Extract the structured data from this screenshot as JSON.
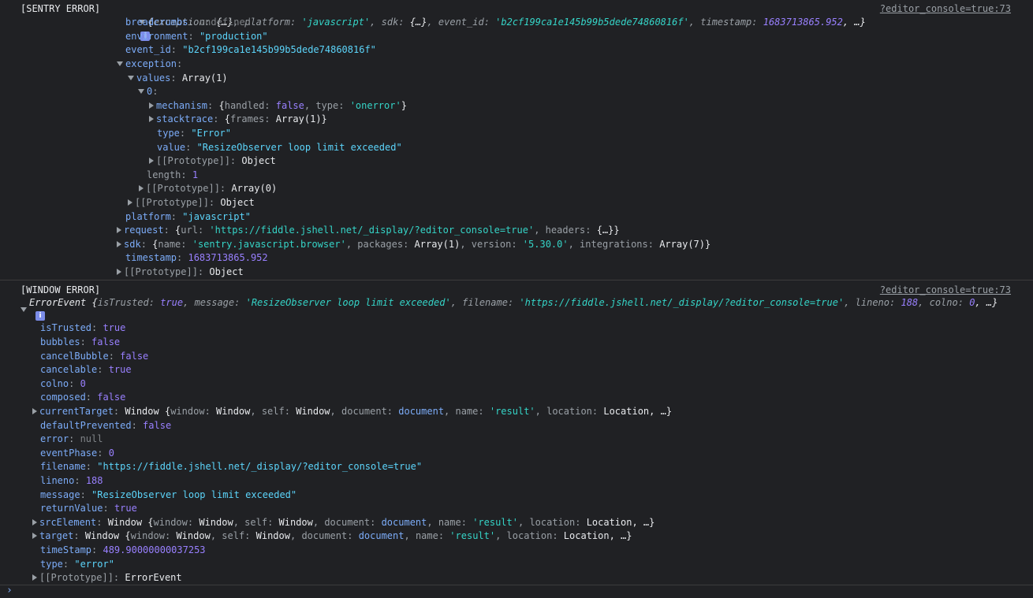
{
  "sentry": {
    "tag": "[SENTRY ERROR]",
    "source": "?editor_console=true:73",
    "summary": {
      "open": "{",
      "k1": "exception",
      "v1": "{…}",
      "k2": "platform",
      "v2": "'javascript'",
      "k3": "sdk",
      "v3": "{…}",
      "k4": "event_id",
      "v4": "'b2cf199ca1e145b99b5dede74860816f'",
      "k5": "timestamp",
      "v5": "1683713865.952",
      "tail": ", …}"
    },
    "breadcrumbs": {
      "key": "breadcrumbs",
      "val": "undefined"
    },
    "environment": {
      "key": "environment",
      "val": "\"production\""
    },
    "event_id": {
      "key": "event_id",
      "val": "\"b2cf199ca1e145b99b5dede74860816f\""
    },
    "exception": {
      "key": "exception"
    },
    "values": {
      "key": "values",
      "val": "Array(1)"
    },
    "index0": {
      "key": "0"
    },
    "mechanism": {
      "key": "mechanism",
      "open": "{",
      "k1": "handled",
      "v1": "false",
      "k2": "type",
      "v2": "'onerror'",
      "close": "}"
    },
    "stacktrace": {
      "key": "stacktrace",
      "open": "{",
      "k1": "frames",
      "v1": "Array(1)",
      "close": "}"
    },
    "type": {
      "key": "type",
      "val": "\"Error\""
    },
    "value": {
      "key": "value",
      "val": "\"ResizeObserver loop limit exceeded\""
    },
    "proto_obj_inner": {
      "key": "[[Prototype]]",
      "val": "Object"
    },
    "length": {
      "key": "length",
      "val": "1"
    },
    "proto_arr": {
      "key": "[[Prototype]]",
      "val": "Array(0)"
    },
    "proto_obj_exc": {
      "key": "[[Prototype]]",
      "val": "Object"
    },
    "platform": {
      "key": "platform",
      "val": "\"javascript\""
    },
    "request": {
      "key": "request",
      "open": "{",
      "k1": "url",
      "v1": "'https://fiddle.jshell.net/_display/?editor_console=true'",
      "k2": "headers",
      "v2": "{…}",
      "close": "}"
    },
    "sdk": {
      "key": "sdk",
      "open": "{",
      "k1": "name",
      "v1": "'sentry.javascript.browser'",
      "k2": "packages",
      "v2": "Array(1)",
      "k3": "version",
      "v3": "'5.30.0'",
      "k4": "integrations",
      "v4": "Array(7)",
      "close": "}"
    },
    "timestamp": {
      "key": "timestamp",
      "val": "1683713865.952"
    },
    "proto_root": {
      "key": "[[Prototype]]",
      "val": "Object"
    }
  },
  "window": {
    "tag": "[WINDOW ERROR]",
    "source": "?editor_console=true:73",
    "summary": {
      "name": "ErrorEvent",
      "open": "{",
      "k1": "isTrusted",
      "v1": "true",
      "k2": "message",
      "v2": "'ResizeObserver loop limit exceeded'",
      "k3": "filename",
      "v3": "'https://fiddle.jshell.net/_display/?editor_console=true'",
      "k4": "lineno",
      "v4": "188",
      "k5": "colno",
      "v5": "0",
      "tail": ", …}"
    },
    "isTrusted": {
      "key": "isTrusted",
      "val": "true"
    },
    "bubbles": {
      "key": "bubbles",
      "val": "false"
    },
    "cancelBubble": {
      "key": "cancelBubble",
      "val": "false"
    },
    "cancelable": {
      "key": "cancelable",
      "val": "true"
    },
    "colno": {
      "key": "colno",
      "val": "0"
    },
    "composed": {
      "key": "composed",
      "val": "false"
    },
    "currentTarget": {
      "key": "currentTarget",
      "cls": "Window",
      "open": "{",
      "k1": "window",
      "v1": "Window",
      "k2": "self",
      "v2": "Window",
      "k3": "document",
      "v3": "document",
      "k4": "name",
      "v4": "'result'",
      "k5": "location",
      "v5": "Location",
      "tail": ", …}"
    },
    "defaultPrevented": {
      "key": "defaultPrevented",
      "val": "false"
    },
    "error": {
      "key": "error",
      "val": "null"
    },
    "eventPhase": {
      "key": "eventPhase",
      "val": "0"
    },
    "filename": {
      "key": "filename",
      "val": "\"https://fiddle.jshell.net/_display/?editor_console=true\""
    },
    "lineno": {
      "key": "lineno",
      "val": "188"
    },
    "message": {
      "key": "message",
      "val": "\"ResizeObserver loop limit exceeded\""
    },
    "returnValue": {
      "key": "returnValue",
      "val": "true"
    },
    "srcElement": {
      "key": "srcElement",
      "cls": "Window",
      "open": "{",
      "k1": "window",
      "v1": "Window",
      "k2": "self",
      "v2": "Window",
      "k3": "document",
      "v3": "document",
      "k4": "name",
      "v4": "'result'",
      "k5": "location",
      "v5": "Location",
      "tail": ", …}"
    },
    "target": {
      "key": "target",
      "cls": "Window",
      "open": "{",
      "k1": "window",
      "v1": "Window",
      "k2": "self",
      "v2": "Window",
      "k3": "document",
      "v3": "document",
      "k4": "name",
      "v4": "'result'",
      "k5": "location",
      "v5": "Location",
      "tail": ", …}"
    },
    "timeStamp": {
      "key": "timeStamp",
      "val": "489.90000000037253"
    },
    "typeField": {
      "key": "type",
      "val": "\"error\""
    },
    "proto": {
      "key": "[[Prototype]]",
      "val": "ErrorEvent"
    }
  },
  "prompt": {
    "symbol": "›"
  },
  "icons": {
    "info": "i"
  }
}
